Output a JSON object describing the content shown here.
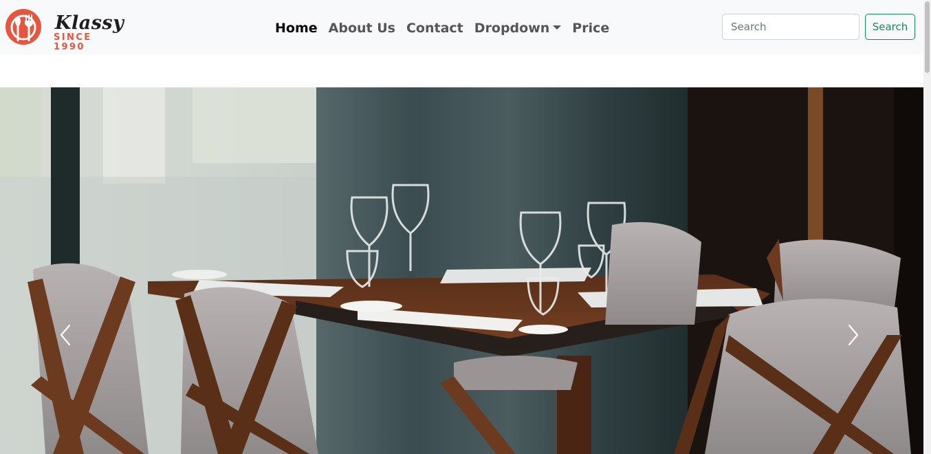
{
  "brand": {
    "name": "Klassy",
    "since": "SINCE 1990",
    "accent": "#e8553f"
  },
  "nav": {
    "items": [
      {
        "label": "Home",
        "active": true
      },
      {
        "label": "About Us",
        "active": false
      },
      {
        "label": "Contact",
        "active": false
      },
      {
        "label": "Dropdown",
        "active": false,
        "has_caret": true
      },
      {
        "label": "Price",
        "active": false
      }
    ]
  },
  "search": {
    "placeholder": "Search",
    "button_label": "Search",
    "button_color": "#198754"
  },
  "carousel": {
    "image": "restaurant-dining-table-with-wine-glasses",
    "prev_icon": "chevron-left-icon",
    "next_icon": "chevron-right-icon"
  }
}
